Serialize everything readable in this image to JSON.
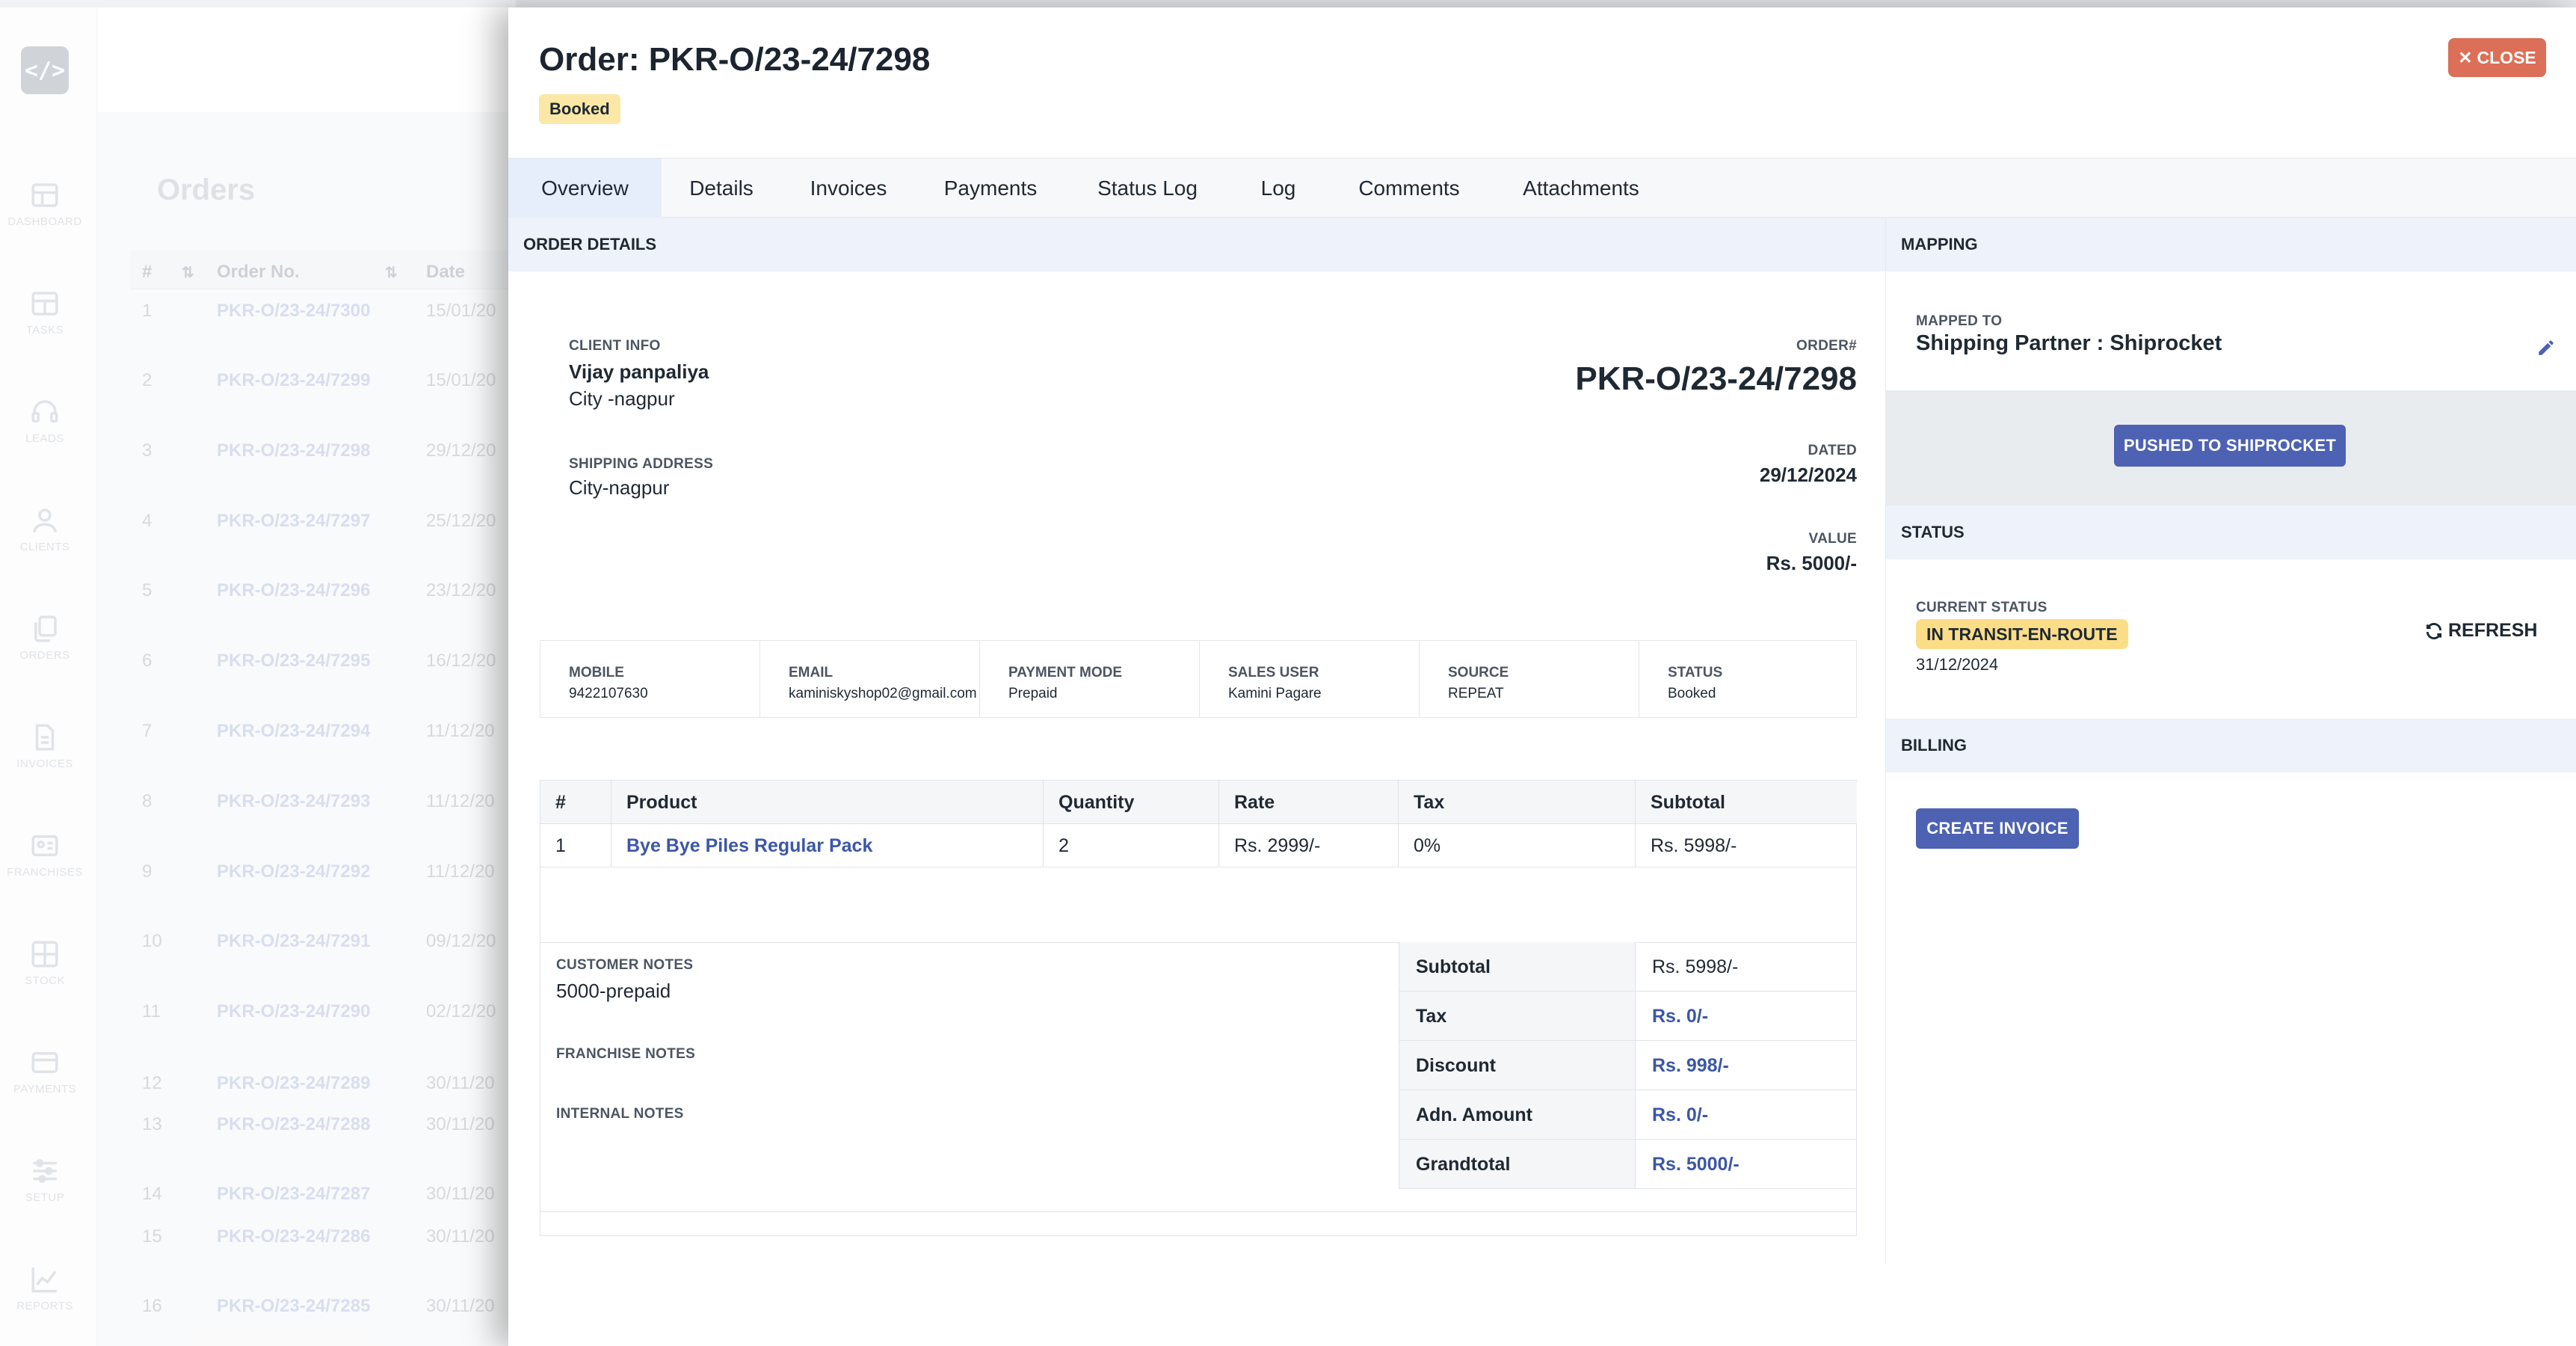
{
  "sidebar": {
    "logo": "</>",
    "items": [
      {
        "label": "DASHBOARD",
        "icon": "dashboard-icon"
      },
      {
        "label": "TASKS",
        "icon": "tasks-icon"
      },
      {
        "label": "LEADS",
        "icon": "headset-icon"
      },
      {
        "label": "CLIENTS",
        "icon": "user-icon"
      },
      {
        "label": "ORDERS",
        "icon": "copy-icon"
      },
      {
        "label": "INVOICES",
        "icon": "document-icon"
      },
      {
        "label": "FRANCHISES",
        "icon": "id-card-icon"
      },
      {
        "label": "STOCK",
        "icon": "grid-icon"
      },
      {
        "label": "PAYMENTS",
        "icon": "card-icon"
      },
      {
        "label": "SETUP",
        "icon": "sliders-icon"
      },
      {
        "label": "REPORTS",
        "icon": "chart-line-icon"
      }
    ]
  },
  "orders_page": {
    "title": "Orders",
    "columns": [
      "#",
      "Order No.",
      "Date"
    ],
    "rows": [
      {
        "n": "1",
        "order": "PKR-O/23-24/7300",
        "date": "15/01/20"
      },
      {
        "n": "2",
        "order": "PKR-O/23-24/7299",
        "date": "15/01/20"
      },
      {
        "n": "3",
        "order": "PKR-O/23-24/7298",
        "date": "29/12/20"
      },
      {
        "n": "4",
        "order": "PKR-O/23-24/7297",
        "date": "25/12/20"
      },
      {
        "n": "5",
        "order": "PKR-O/23-24/7296",
        "date": "23/12/20"
      },
      {
        "n": "6",
        "order": "PKR-O/23-24/7295",
        "date": "16/12/20"
      },
      {
        "n": "7",
        "order": "PKR-O/23-24/7294",
        "date": "11/12/20"
      },
      {
        "n": "8",
        "order": "PKR-O/23-24/7293",
        "date": "11/12/20"
      },
      {
        "n": "9",
        "order": "PKR-O/23-24/7292",
        "date": "11/12/20"
      },
      {
        "n": "10",
        "order": "PKR-O/23-24/7291",
        "date": "09/12/20"
      },
      {
        "n": "11",
        "order": "PKR-O/23-24/7290",
        "date": "02/12/20"
      },
      {
        "n": "12",
        "order": "PKR-O/23-24/7289",
        "date": "30/11/20"
      },
      {
        "n": "13",
        "order": "PKR-O/23-24/7288",
        "date": "30/11/20"
      },
      {
        "n": "14",
        "order": "PKR-O/23-24/7287",
        "date": "30/11/20"
      },
      {
        "n": "15",
        "order": "PKR-O/23-24/7286",
        "date": "30/11/20"
      },
      {
        "n": "16",
        "order": "PKR-O/23-24/7285",
        "date": "30/11/20"
      }
    ]
  },
  "drawer": {
    "title": "Order: PKR-O/23-24/7298",
    "status_badge": "Booked",
    "close_label": "CLOSE",
    "tabs": [
      "Overview",
      "Details",
      "Invoices",
      "Payments",
      "Status Log",
      "Log",
      "Comments",
      "Attachments"
    ],
    "order_details": {
      "section_title": "ORDER DETAILS",
      "client_info_label": "CLIENT INFO",
      "client_name": "Vijay panpaliya",
      "client_city": "City -nagpur",
      "shipping_label": "SHIPPING ADDRESS",
      "shipping_address": "City-nagpur",
      "order_no_label": "ORDER#",
      "order_no": "PKR-O/23-24/7298",
      "dated_label": "DATED",
      "dated": "29/12/2024",
      "value_label": "VALUE",
      "value": "Rs. 5000/-",
      "info": [
        {
          "key": "MOBILE",
          "value": "9422107630"
        },
        {
          "key": "EMAIL",
          "value": "kaminiskyshop02@gmail.com"
        },
        {
          "key": "PAYMENT MODE",
          "value": "Prepaid"
        },
        {
          "key": "SALES USER",
          "value": "Kamini Pagare"
        },
        {
          "key": "SOURCE",
          "value": "REPEAT"
        },
        {
          "key": "STATUS",
          "value": "Booked"
        }
      ],
      "product_table": {
        "columns": [
          "#",
          "Product",
          "Quantity",
          "Rate",
          "Tax",
          "Subtotal"
        ],
        "rows": [
          {
            "n": "1",
            "product": "Bye Bye Piles Regular Pack",
            "quantity": "2",
            "rate": "Rs. 2999/-",
            "tax": "0%",
            "subtotal": "Rs. 5998/-"
          }
        ]
      },
      "customer_notes_label": "CUSTOMER NOTES",
      "customer_notes": "5000-prepaid",
      "franchise_notes_label": "FRANCHISE NOTES",
      "internal_notes_label": "INTERNAL NOTES",
      "totals": [
        {
          "label": "Subtotal",
          "value": "Rs. 5998/-"
        },
        {
          "label": "Tax",
          "value": "Rs. 0/-"
        },
        {
          "label": "Discount",
          "value": "Rs. 998/-"
        },
        {
          "label": "Adn. Amount",
          "value": "Rs. 0/-"
        },
        {
          "label": "Grandtotal",
          "value": "Rs. 5000/-"
        }
      ]
    },
    "mapping": {
      "section_title": "MAPPING",
      "mapped_to_label": "MAPPED TO",
      "mapped_to": "Shipping Partner : Shiprocket",
      "pushed_button": "PUSHED TO SHIPROCKET"
    },
    "status": {
      "section_title": "STATUS",
      "current_status_label": "CURRENT STATUS",
      "current_status": "IN TRANSIT-EN-ROUTE",
      "date": "31/12/2024",
      "refresh_label": "REFRESH"
    },
    "billing": {
      "section_title": "BILLING",
      "create_invoice": "CREATE INVOICE"
    }
  },
  "colors": {
    "accent_blue": "#4d62b3",
    "link_blue": "#3b57a6",
    "close_red": "#dc6f57",
    "booked_badge": "#fbe8a6",
    "transit_badge": "#fbdd88"
  }
}
